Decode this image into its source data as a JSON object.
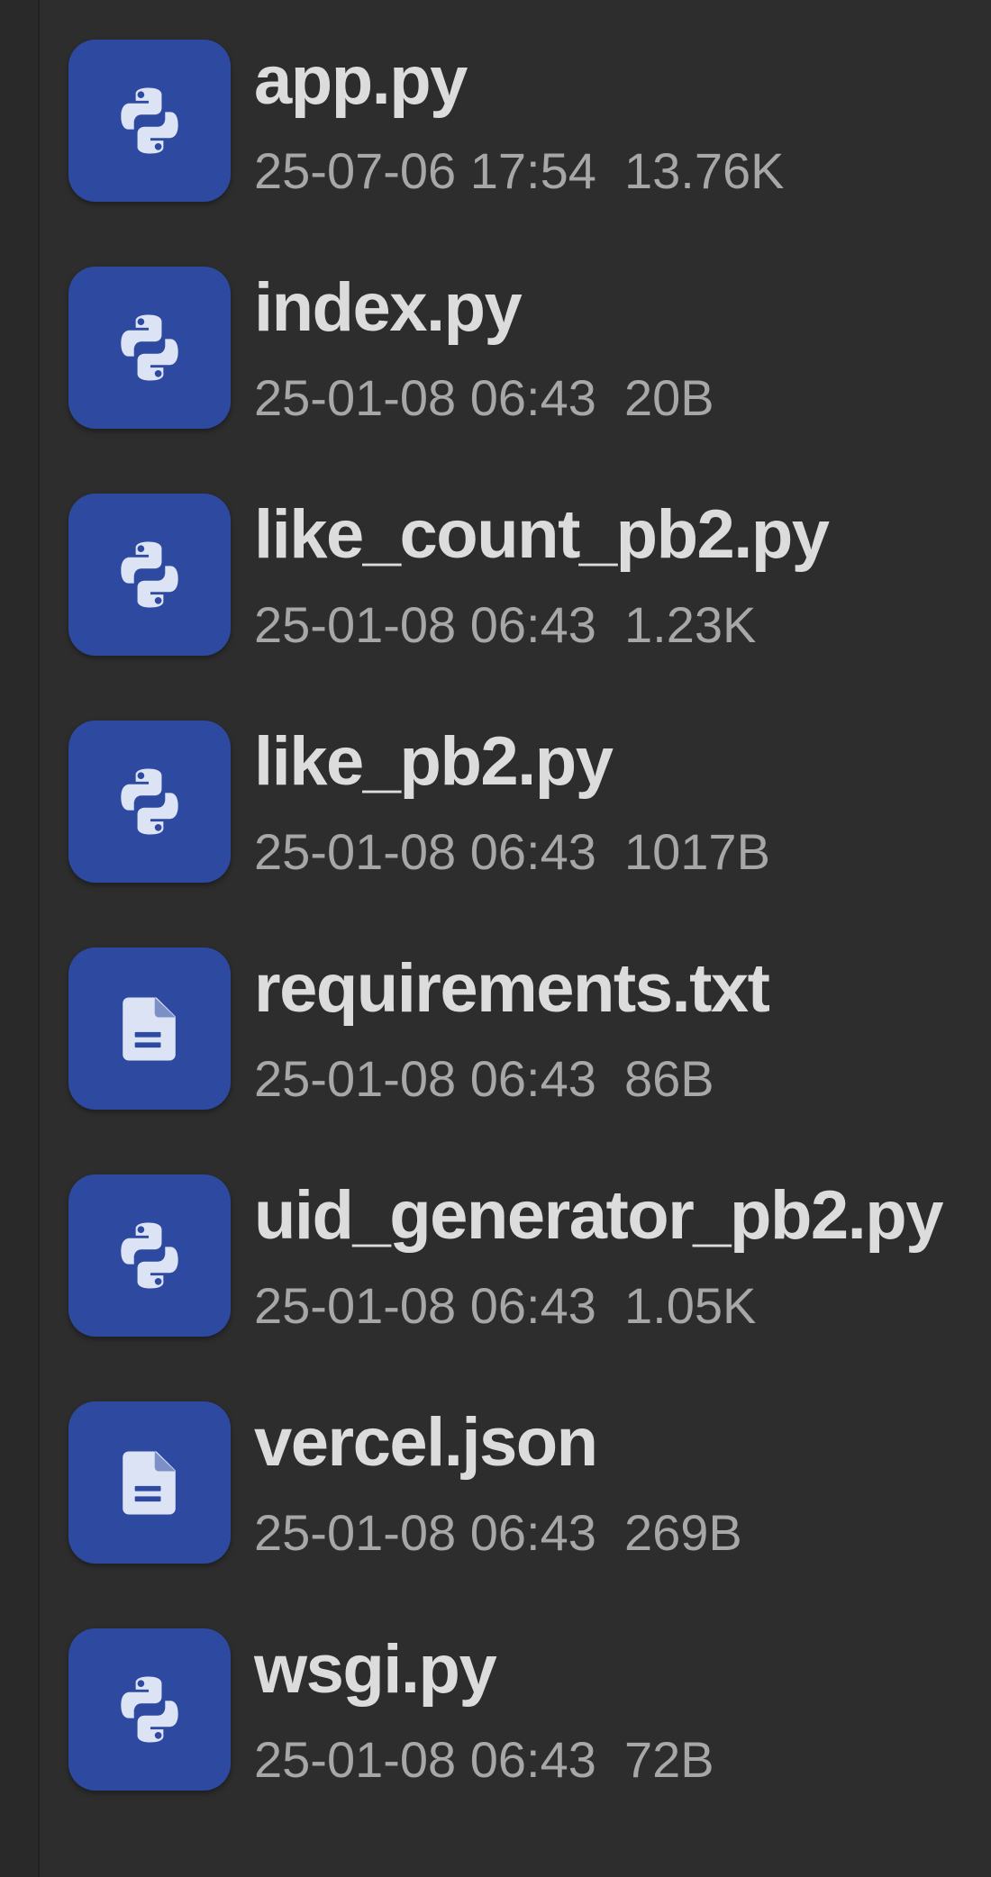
{
  "files": [
    {
      "name": "app.py",
      "date": "25-07-06 17:54",
      "size": "13.76K",
      "icon": "python-file-icon"
    },
    {
      "name": "index.py",
      "date": "25-01-08 06:43",
      "size": "20B",
      "icon": "python-file-icon"
    },
    {
      "name": "like_count_pb2.py",
      "date": "25-01-08 06:43",
      "size": "1.23K",
      "icon": "python-file-icon"
    },
    {
      "name": "like_pb2.py",
      "date": "25-01-08 06:43",
      "size": "1017B",
      "icon": "python-file-icon"
    },
    {
      "name": "requirements.txt",
      "date": "25-01-08 06:43",
      "size": "86B",
      "icon": "document-file-icon"
    },
    {
      "name": "uid_generator_pb2.py",
      "date": "25-01-08 06:43",
      "size": "1.05K",
      "icon": "python-file-icon"
    },
    {
      "name": "vercel.json",
      "date": "25-01-08 06:43",
      "size": "269B",
      "icon": "document-file-icon"
    },
    {
      "name": "wsgi.py",
      "date": "25-01-08 06:43",
      "size": "72B",
      "icon": "python-file-icon"
    }
  ],
  "colors": {
    "background": "#2d2d2e",
    "icon_tile": "#2d4aa0",
    "icon_glyph": "#dce3f4",
    "name_text": "#dcdcdc",
    "meta_text": "#a7a7a7"
  }
}
